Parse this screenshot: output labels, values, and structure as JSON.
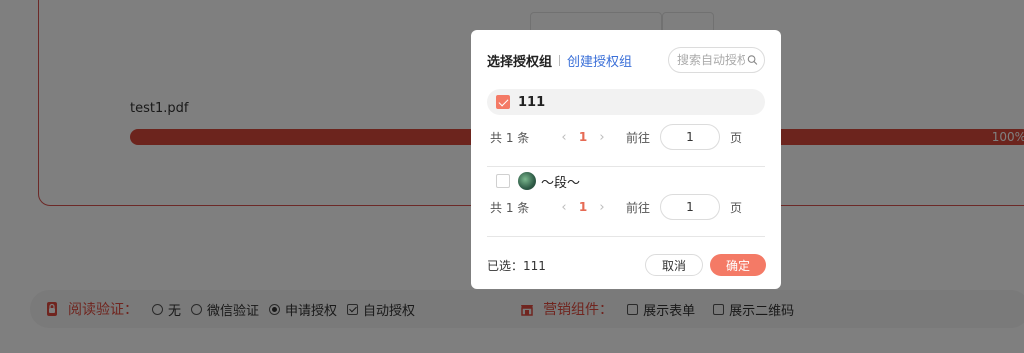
{
  "background": {
    "file_name": "test1.pdf",
    "progress_text": "100%",
    "progress": 1.0,
    "read_verify": {
      "title": "阅读验证：",
      "options": [
        {
          "label": "无",
          "type": "radio",
          "checked": false
        },
        {
          "label": "微信验证",
          "type": "radio",
          "checked": false
        },
        {
          "label": "申请授权",
          "type": "radio",
          "checked": true
        },
        {
          "label": "自动授权",
          "type": "checkbox",
          "checked": true
        }
      ]
    },
    "marketing": {
      "title": "营销组件：",
      "options": [
        {
          "label": "展示表单",
          "checked": false
        },
        {
          "label": "展示二维码",
          "checked": false
        }
      ]
    }
  },
  "dialog": {
    "title": "选择授权组",
    "create_link": "创建授权组",
    "search_placeholder": "搜索自动授权组",
    "groups": [
      {
        "name": "111",
        "checked": true,
        "pager": {
          "total": "共 1 条",
          "prev": "‹",
          "page": "1",
          "next": "›",
          "goto": "前往",
          "input": "1",
          "unit": "页"
        }
      },
      {
        "name": "～段～",
        "checked": false,
        "pager": {
          "total": "共 1 条",
          "prev": "‹",
          "page": "1",
          "next": "›",
          "goto": "前往",
          "input": "1",
          "unit": "页"
        }
      }
    ],
    "selected_text": "已选：111",
    "cancel_label": "取消",
    "ok_label": "确定"
  },
  "colors": {
    "accent": "#f47a66",
    "link": "#3a6fd8",
    "brand_red": "#d9483b"
  }
}
